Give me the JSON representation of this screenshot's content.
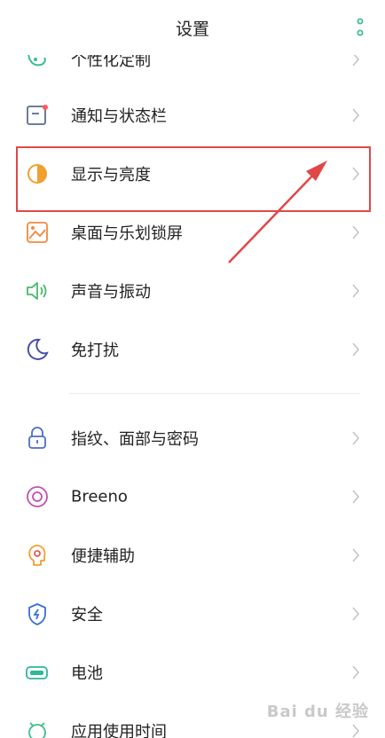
{
  "header": {
    "title": "设置",
    "more_icon": "more-vertical-icon"
  },
  "items": [
    {
      "label": "个性化定制",
      "icon": "personalize-icon"
    },
    {
      "label": "通知与状态栏",
      "icon": "notification-icon"
    },
    {
      "label": "显示与亮度",
      "icon": "brightness-icon"
    },
    {
      "label": "桌面与乐划锁屏",
      "icon": "wallpaper-icon"
    },
    {
      "label": "声音与振动",
      "icon": "sound-icon"
    },
    {
      "label": "免打扰",
      "icon": "moon-icon"
    },
    {
      "label": "指纹、面部与密码",
      "icon": "lock-icon"
    },
    {
      "label": "Breeno",
      "icon": "breeno-icon"
    },
    {
      "label": "便捷辅助",
      "icon": "assist-icon"
    },
    {
      "label": "安全",
      "icon": "shield-icon"
    },
    {
      "label": "电池",
      "icon": "battery-icon"
    },
    {
      "label": "应用使用时间",
      "icon": "app-usage-icon"
    }
  ],
  "watermark": "Bai du 经验",
  "colors": {
    "accent_green": "#3dbd8c",
    "highlight_red": "#e04848"
  }
}
